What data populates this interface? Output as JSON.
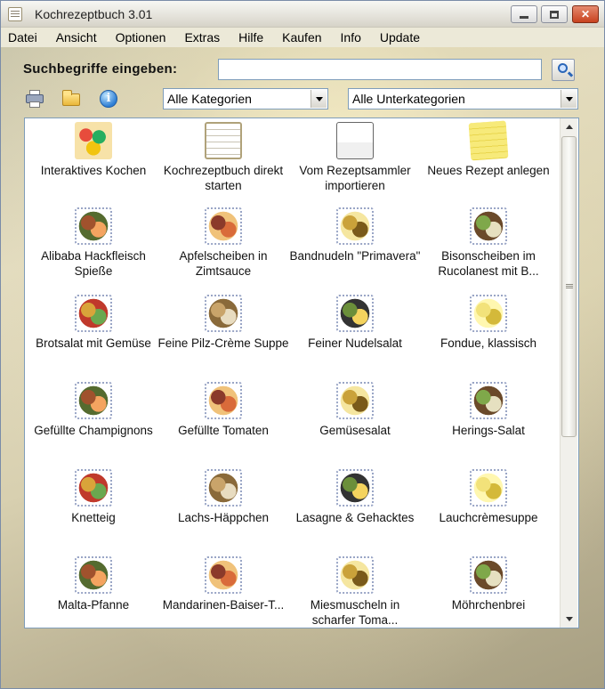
{
  "window": {
    "title": "Kochrezeptbuch 3.01",
    "controls": {
      "minimize": "minimize",
      "maximize": "maximize",
      "close": "✕"
    }
  },
  "menu": [
    "Datei",
    "Ansicht",
    "Optionen",
    "Extras",
    "Hilfe",
    "Kaufen",
    "Info",
    "Update"
  ],
  "search": {
    "label": "Suchbegriffe eingeben:",
    "value": "",
    "button_icon": "magnifier-icon"
  },
  "toolbar": {
    "icons": [
      "printer-icon",
      "open-folder-icon",
      "info-icon"
    ],
    "info_glyph": "i"
  },
  "filters": {
    "category": "Alle Kategorien",
    "subcategory": "Alle Unterkategorien"
  },
  "items": [
    {
      "label": "Interaktives Kochen",
      "icon": "cooking-icon"
    },
    {
      "label": "Kochrezeptbuch direkt starten",
      "icon": "calendar-book-icon"
    },
    {
      "label": "Vom Rezeptsammler importieren",
      "icon": "import-icon"
    },
    {
      "label": "Neues Rezept anlegen",
      "icon": "new-recipe-note-icon"
    },
    {
      "label": "Alibaba Hackfleisch Spieße",
      "icon": "recipe-photo"
    },
    {
      "label": "Apfelscheiben in Zimtsauce",
      "icon": "recipe-photo"
    },
    {
      "label": "Bandnudeln \"Primavera\"",
      "icon": "recipe-photo"
    },
    {
      "label": "Bisonscheiben im Rucolanest mit B...",
      "icon": "recipe-photo"
    },
    {
      "label": "Brotsalat mit Gemüse",
      "icon": "recipe-photo"
    },
    {
      "label": "Feine Pilz-Crème Suppe",
      "icon": "recipe-photo"
    },
    {
      "label": "Feiner Nudelsalat",
      "icon": "recipe-photo"
    },
    {
      "label": "Fondue, klassisch",
      "icon": "recipe-photo"
    },
    {
      "label": "Gefüllte Champignons",
      "icon": "recipe-photo"
    },
    {
      "label": "Gefüllte Tomaten",
      "icon": "recipe-photo"
    },
    {
      "label": "Gemüsesalat",
      "icon": "recipe-photo"
    },
    {
      "label": "Herings-Salat",
      "icon": "recipe-photo"
    },
    {
      "label": "Knetteig",
      "icon": "recipe-photo"
    },
    {
      "label": "Lachs-Häppchen",
      "icon": "recipe-photo"
    },
    {
      "label": "Lasagne & Gehacktes",
      "icon": "recipe-photo"
    },
    {
      "label": "Lauchcrèmesuppe",
      "icon": "recipe-photo"
    },
    {
      "label": "Malta-Pfanne",
      "icon": "recipe-photo"
    },
    {
      "label": "Mandarinen-Baiser-T...",
      "icon": "recipe-photo"
    },
    {
      "label": "Miesmuscheln in scharfer Toma...",
      "icon": "recipe-photo"
    },
    {
      "label": "Möhrchenbrei",
      "icon": "recipe-photo"
    }
  ],
  "colors": {
    "window_border": "#7a8ca8",
    "panel_border": "#7f9db9",
    "close_button": "#c8421f"
  }
}
